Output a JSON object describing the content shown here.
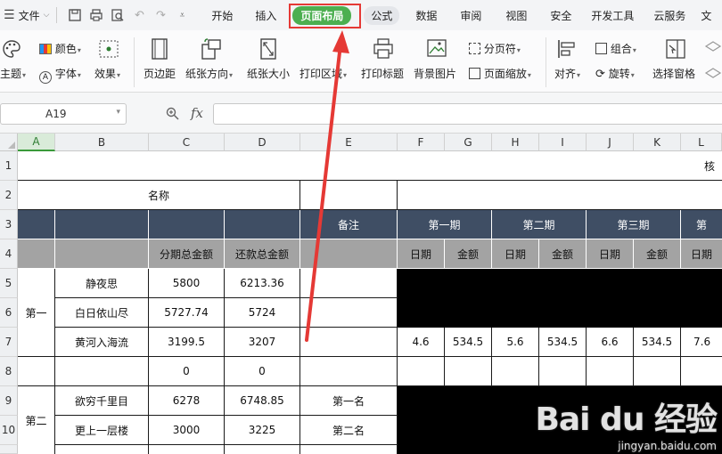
{
  "menubar": {
    "file_label": "文件",
    "tabs": [
      "开始",
      "插入",
      "页面布局",
      "公式",
      "数据",
      "审阅",
      "视图",
      "安全",
      "开发工具",
      "云服务",
      "文"
    ]
  },
  "ribbon": {
    "theme": "主题",
    "color": "颜色",
    "font": "字体",
    "effect": "效果",
    "margins": "页边距",
    "orientation": "纸张方向",
    "size": "纸张大小",
    "print_area": "打印区域",
    "print_titles": "打印标题",
    "background": "背景图片",
    "page_break": "分页符",
    "page_zoom": "页面缩放",
    "align": "对齐",
    "group": "组合",
    "rotate": "旋转",
    "selection_pane": "选择窗格"
  },
  "formula_bar": {
    "cell_ref": "A19",
    "fx_label": "fx",
    "value": ""
  },
  "columns": [
    "A",
    "B",
    "C",
    "D",
    "E",
    "F",
    "G",
    "H",
    "I",
    "J",
    "K",
    "L"
  ],
  "rows": [
    "1",
    "2",
    "3",
    "4",
    "5",
    "6",
    "7",
    "8",
    "9",
    "10"
  ],
  "sheet": {
    "r1_partial": "核",
    "r2_name": "名称",
    "r3_note": "备注",
    "r3_periods": [
      "第一期",
      "第二期",
      "第三期",
      "第"
    ],
    "r4_total_installment": "分期总金额",
    "r4_total_repayment": "还款总金额",
    "r4_date": "日期",
    "r4_amount": "金额",
    "group1": "第一",
    "group2": "第二",
    "items": [
      {
        "name": "静夜思",
        "c": "5800",
        "d": "6213.36",
        "e": ""
      },
      {
        "name": "白日依山尽",
        "c": "5727.74",
        "d": "5724",
        "e": ""
      },
      {
        "name": "黄河入海流",
        "c": "3199.5",
        "d": "3207",
        "e": ""
      },
      {
        "name": "",
        "c": "0",
        "d": "0",
        "e": ""
      },
      {
        "name": "欲穷千里目",
        "c": "6278",
        "d": "6748.85",
        "e": "第一名"
      },
      {
        "name": "更上一层楼",
        "c": "3000",
        "d": "3225",
        "e": "第二名"
      }
    ],
    "row7_values": [
      "4.6",
      "534.5",
      "5.6",
      "534.5",
      "6.6",
      "534.5",
      "7.6"
    ]
  },
  "watermark": {
    "logo": "Bai du 经验",
    "url": "jingyan.baidu.com"
  },
  "colors": {
    "accent": "#4caf50",
    "header_dark": "#3f4e64",
    "header_gray": "#a3a3a3",
    "annotation": "#e53935"
  }
}
